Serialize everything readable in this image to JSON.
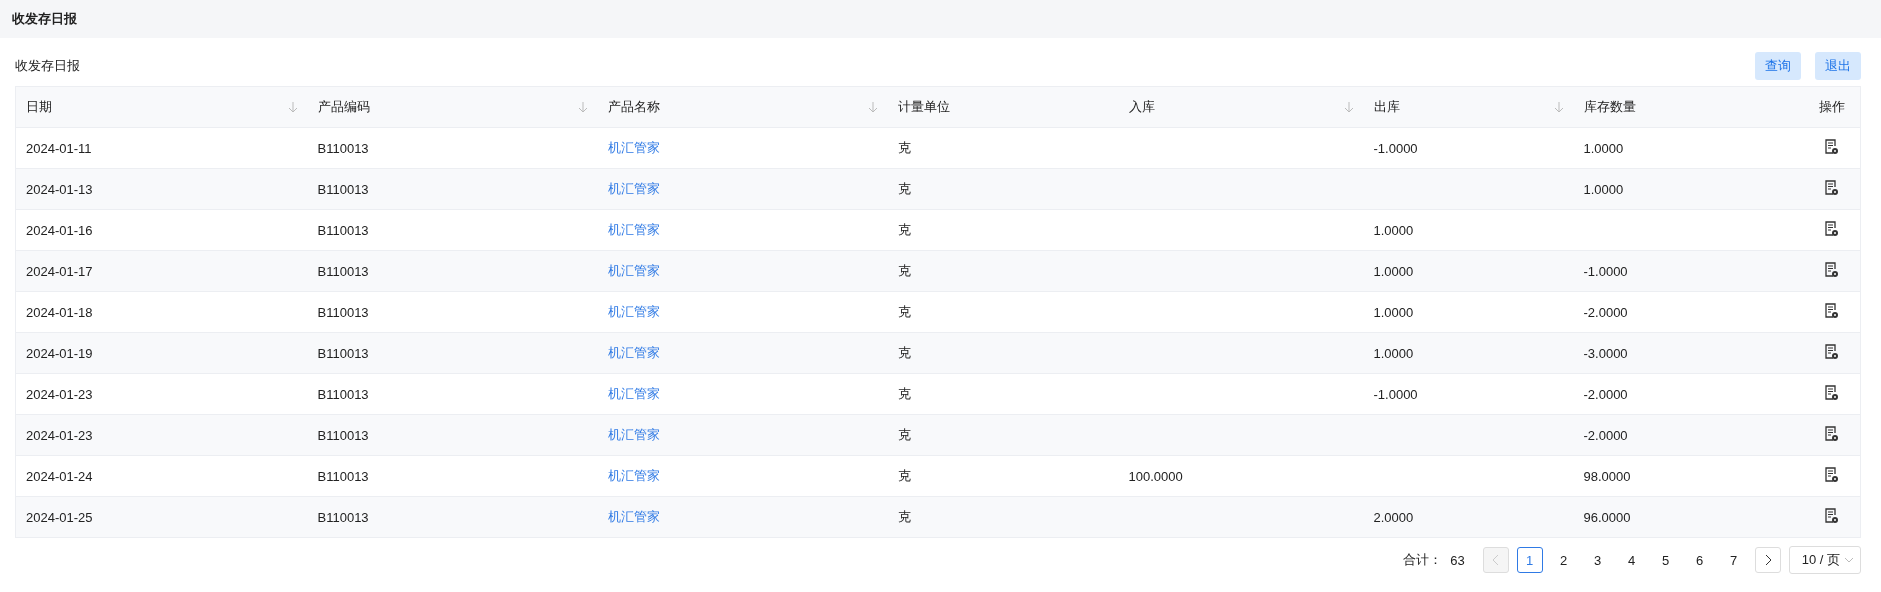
{
  "page_title": "收发存日报",
  "card": {
    "title": "收发存日报",
    "buttons": [
      "查询",
      "退出"
    ]
  },
  "table": {
    "columns": [
      {
        "label": "日期",
        "sortable": true
      },
      {
        "label": "产品编码",
        "sortable": true
      },
      {
        "label": "产品名称",
        "sortable": true
      },
      {
        "label": "计量单位",
        "sortable": false
      },
      {
        "label": "入库",
        "sortable": true
      },
      {
        "label": "出库",
        "sortable": true
      },
      {
        "label": "库存数量",
        "sortable": false
      },
      {
        "label": "操作",
        "sortable": false
      }
    ],
    "rows": [
      {
        "date": "2024-01-11",
        "code": "B110013",
        "name": "机汇管家",
        "unit": "克",
        "in": "",
        "out": "-1.0000",
        "stock": "1.0000"
      },
      {
        "date": "2024-01-13",
        "code": "B110013",
        "name": "机汇管家",
        "unit": "克",
        "in": "",
        "out": "",
        "stock": "1.0000"
      },
      {
        "date": "2024-01-16",
        "code": "B110013",
        "name": "机汇管家",
        "unit": "克",
        "in": "",
        "out": "1.0000",
        "stock": ""
      },
      {
        "date": "2024-01-17",
        "code": "B110013",
        "name": "机汇管家",
        "unit": "克",
        "in": "",
        "out": "1.0000",
        "stock": "-1.0000"
      },
      {
        "date": "2024-01-18",
        "code": "B110013",
        "name": "机汇管家",
        "unit": "克",
        "in": "",
        "out": "1.0000",
        "stock": "-2.0000"
      },
      {
        "date": "2024-01-19",
        "code": "B110013",
        "name": "机汇管家",
        "unit": "克",
        "in": "",
        "out": "1.0000",
        "stock": "-3.0000"
      },
      {
        "date": "2024-01-23",
        "code": "B110013",
        "name": "机汇管家",
        "unit": "克",
        "in": "",
        "out": "-1.0000",
        "stock": "-2.0000"
      },
      {
        "date": "2024-01-23",
        "code": "B110013",
        "name": "机汇管家",
        "unit": "克",
        "in": "",
        "out": "",
        "stock": "-2.0000"
      },
      {
        "date": "2024-01-24",
        "code": "B110013",
        "name": "机汇管家",
        "unit": "克",
        "in": "100.0000",
        "out": "",
        "stock": "98.0000"
      },
      {
        "date": "2024-01-25",
        "code": "B110013",
        "name": "机汇管家",
        "unit": "克",
        "in": "",
        "out": "2.0000",
        "stock": "96.0000"
      }
    ]
  },
  "pagination": {
    "total_label": "合计：",
    "total": "63",
    "pages": [
      {
        "label": "1",
        "selected": true
      },
      {
        "label": "2",
        "selected": false
      },
      {
        "label": "3",
        "selected": false
      },
      {
        "label": "4",
        "selected": false
      },
      {
        "label": "5",
        "selected": false
      },
      {
        "label": "6",
        "selected": false
      },
      {
        "label": "7",
        "selected": false
      }
    ],
    "page_size": "10 / 页"
  }
}
